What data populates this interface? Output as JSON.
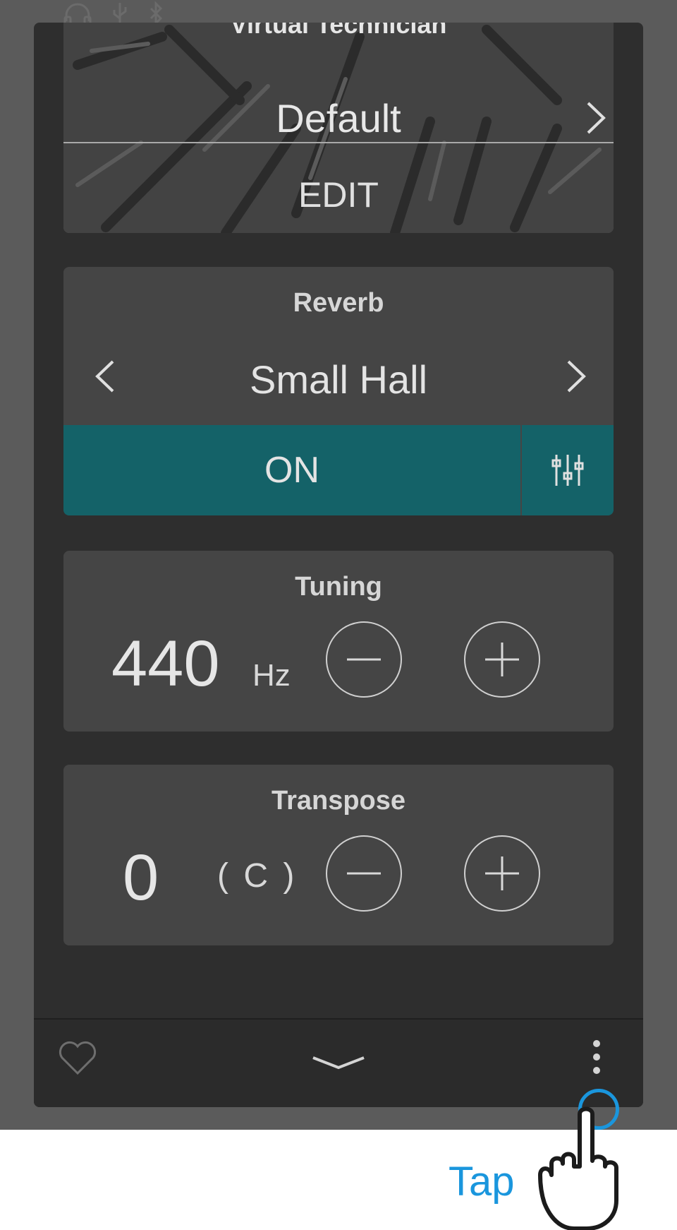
{
  "status_icons": [
    "headphones-icon",
    "usb-icon",
    "bluetooth-icon"
  ],
  "virtual_technician": {
    "title": "Virtual Technician",
    "value": "Default",
    "edit_label": "EDIT"
  },
  "reverb": {
    "title": "Reverb",
    "value": "Small Hall",
    "toggle_label": "ON"
  },
  "tuning": {
    "title": "Tuning",
    "value": "440",
    "unit": "Hz"
  },
  "transpose": {
    "title": "Transpose",
    "value": "0",
    "key": "( C )"
  },
  "annotation": {
    "label": "Tap"
  },
  "colors": {
    "accent": "#146268",
    "annotation": "#1a96dd",
    "panel": "#2e2e2e",
    "card": "#454545"
  }
}
